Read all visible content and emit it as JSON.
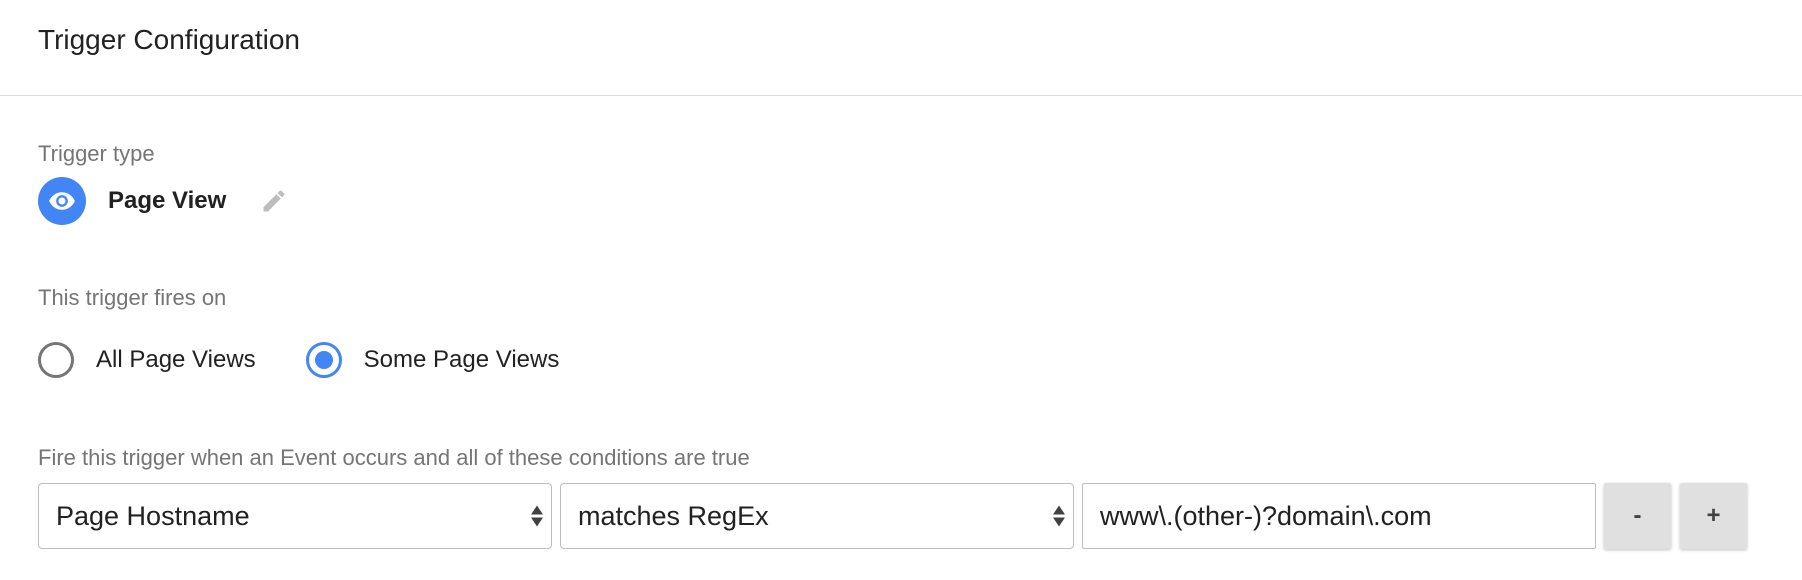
{
  "panel": {
    "title": "Trigger Configuration"
  },
  "trigger_type": {
    "label": "Trigger type",
    "name": "Page View",
    "icon": "eye-icon",
    "icon_color": "#4285f4",
    "edit_icon": "pencil-icon"
  },
  "fires_on": {
    "label": "This trigger fires on",
    "options": [
      {
        "label": "All Page Views",
        "selected": false
      },
      {
        "label": "Some Page Views",
        "selected": true
      }
    ]
  },
  "conditions": {
    "label": "Fire this trigger when an Event occurs and all of these conditions are true",
    "rows": [
      {
        "variable": "Page Hostname",
        "operator": "matches RegEx",
        "value": "www\\.(other-)?domain\\.com",
        "remove_label": "-",
        "add_label": "+"
      }
    ]
  },
  "colors": {
    "accent": "#4285f4",
    "label_gray": "#757575",
    "text": "#212121",
    "button_bg": "#e0e0e0"
  }
}
